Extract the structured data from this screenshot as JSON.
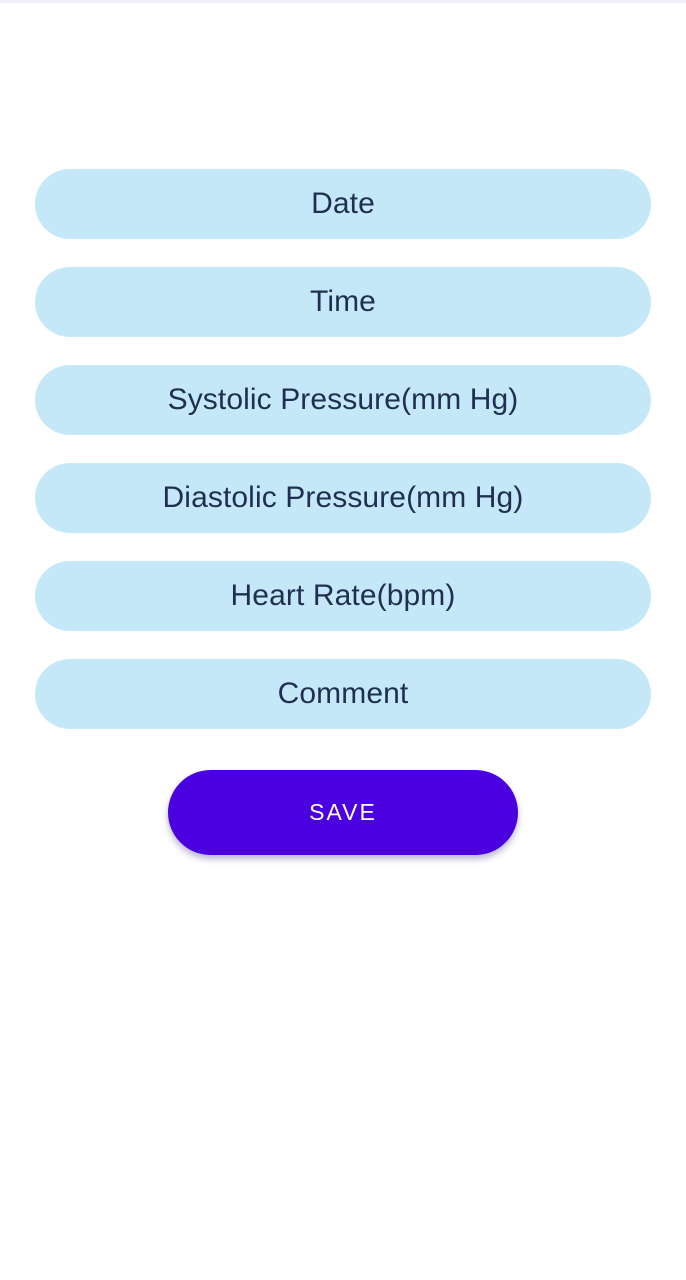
{
  "form": {
    "fields": [
      {
        "placeholder": "Date"
      },
      {
        "placeholder": "Time"
      },
      {
        "placeholder": "Systolic Pressure(mm Hg)"
      },
      {
        "placeholder": "Diastolic Pressure(mm Hg)"
      },
      {
        "placeholder": "Heart Rate(bpm)"
      },
      {
        "placeholder": "Comment"
      }
    ],
    "save_label": "SAVE"
  },
  "colors": {
    "field_background": "#c5e8f9",
    "field_text": "#1f2f50",
    "button_background": "#4b00e0",
    "button_text": "#ffffff"
  }
}
